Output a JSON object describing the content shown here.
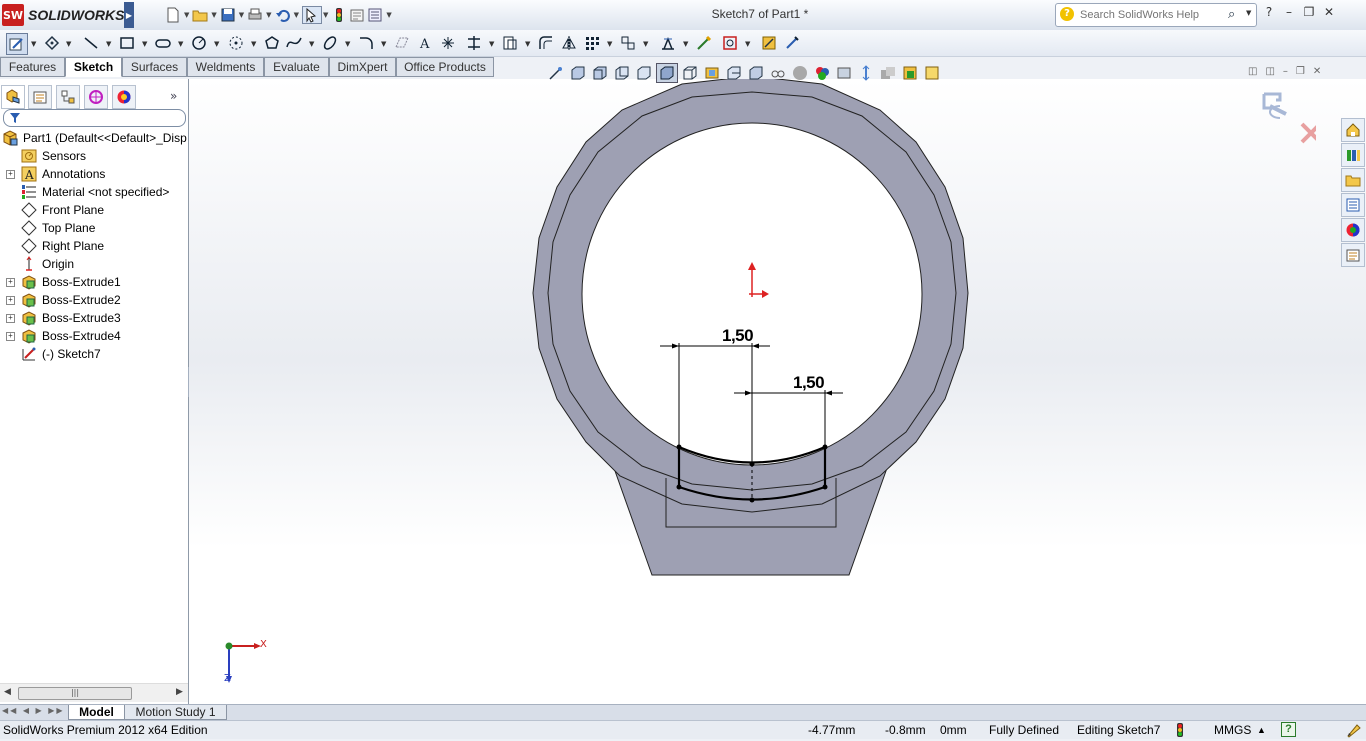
{
  "app": {
    "name": "SOLIDWORKS",
    "logo_mark": "SW"
  },
  "window": {
    "title": "Sketch7 of Part1 *"
  },
  "search": {
    "placeholder": "Search SolidWorks Help",
    "value": "Search SolidWorks Help"
  },
  "window_controls": {
    "help": "?",
    "minimize": "–",
    "restore": "❐",
    "close": "✕"
  },
  "tabs": [
    "Features",
    "Sketch",
    "Surfaces",
    "Weldments",
    "Evaluate",
    "DimXpert",
    "Office Products"
  ],
  "active_tab": "Sketch",
  "feature_tree": {
    "root": "Part1  (Default<<Default>_Disp",
    "items": [
      {
        "label": "Sensors",
        "icon": "sensors-icon"
      },
      {
        "label": "Annotations",
        "icon": "annotations-icon"
      },
      {
        "label": "Material <not specified>",
        "icon": "material-icon"
      },
      {
        "label": "Front Plane",
        "icon": "plane-icon"
      },
      {
        "label": "Top Plane",
        "icon": "plane-icon"
      },
      {
        "label": "Right Plane",
        "icon": "plane-icon"
      },
      {
        "label": "Origin",
        "icon": "origin-icon"
      },
      {
        "label": "Boss-Extrude1",
        "icon": "boss-extrude-icon"
      },
      {
        "label": "Boss-Extrude2",
        "icon": "boss-extrude-icon"
      },
      {
        "label": "Boss-Extrude3",
        "icon": "boss-extrude-icon"
      },
      {
        "label": "Boss-Extrude4",
        "icon": "boss-extrude-icon"
      },
      {
        "label": "(-) Sketch7",
        "icon": "sketch-icon"
      }
    ]
  },
  "dimensions": {
    "d1": "1,50",
    "d2": "1,50"
  },
  "triad": {
    "x": "X",
    "z": "Z"
  },
  "model_tabs": [
    "Model",
    "Motion Study 1"
  ],
  "model_tabs_nav": "◀◀ ◀ ▶ ▶▶",
  "status": {
    "edition": "SolidWorks Premium 2012 x64 Edition",
    "x": "-4.77mm",
    "y": "-0.8mm",
    "z": "0mm",
    "state": "Fully Defined",
    "editing": "Editing Sketch7",
    "units": "MMGS",
    "units_arrow": "▲",
    "help": "?"
  },
  "colors": {
    "part_face": "#9ea0b3",
    "accent": "#c8201f",
    "sketch_line": "#000000"
  }
}
